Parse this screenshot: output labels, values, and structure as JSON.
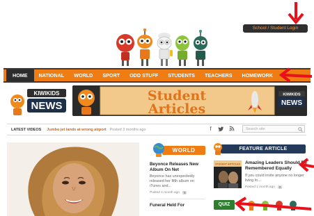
{
  "header": {
    "login_label": "School / Student Login"
  },
  "nav": {
    "items": [
      "HOME",
      "NATIONAL",
      "WORLD",
      "SPORT",
      "ODD STUFF",
      "STUDENTS",
      "TEACHERS",
      "HOMEWORK"
    ]
  },
  "banner": {
    "logo_top": "KIWIKIDS",
    "logo_bottom": "NEWS",
    "line1": "Student",
    "line2": "Articles",
    "badge_top": "KIWIKIDS",
    "badge_bottom": "NEWS"
  },
  "latest": {
    "label": "LATEST VIDEOS",
    "video_title": "Jumbo jet lands at wrong airport",
    "posted": "Posted 3 months ago",
    "search_placeholder": "Search site"
  },
  "world": {
    "section_label": "WORLD",
    "article1_title": "Beyonce Releases New Album On Net",
    "article1_excerpt": "Beyonce has unexpectedly released her fifth album on iTunes and...",
    "article1_posted": "Posted 1 month ago",
    "article1_count": "0",
    "article2_title": "Funeral Held For"
  },
  "feature": {
    "section_label": "FEATURE ARTICLE",
    "thumb_label": "STUDENT ARTICLES",
    "title": "Amazing Leaders Should Be Remembered Equally",
    "excerpt": "If you could invite anyone no longer living to...",
    "posted": "Posted 1 month ago",
    "count": "0",
    "quiz_label": "QUIZ"
  },
  "colors": {
    "nav_orange": "#f07d14",
    "nav_dark": "#2d2d2d",
    "feature_navy": "#243a5a",
    "annotation_red": "#e8101a"
  }
}
